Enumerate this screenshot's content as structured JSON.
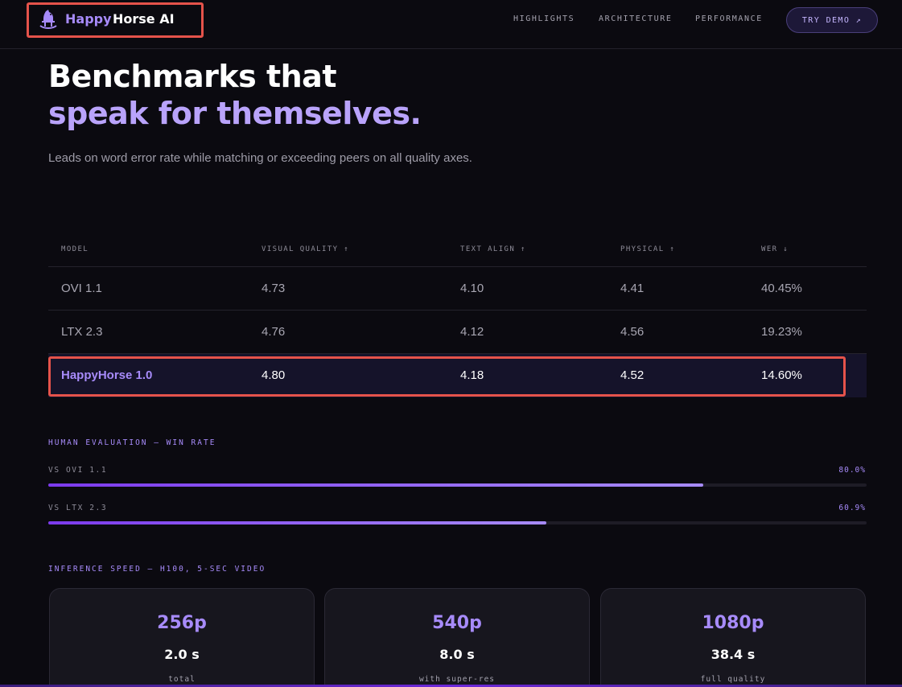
{
  "header": {
    "logo_icon": "rocking-horse-icon",
    "logo_happy": "Happy",
    "logo_horse": "Horse AI",
    "nav": [
      "HIGHLIGHTS",
      "ARCHITECTURE",
      "PERFORMANCE"
    ],
    "cta": "TRY DEMO ↗"
  },
  "hero": {
    "title_line1": "Benchmarks that",
    "title_line2": "speak for themselves.",
    "subtitle": "Leads on word error rate while matching or exceeding peers on all quality axes."
  },
  "table": {
    "headers": [
      "MODEL",
      "VISUAL QUALITY ↑",
      "TEXT ALIGN ↑",
      "PHYSICAL ↑",
      "WER ↓"
    ],
    "rows": [
      [
        "OVI 1.1",
        "4.73",
        "4.10",
        "4.41",
        "40.45%"
      ],
      [
        "LTX 2.3",
        "4.76",
        "4.12",
        "4.56",
        "19.23%"
      ],
      [
        "HappyHorse 1.0",
        "4.80",
        "4.18",
        "4.52",
        "14.60%"
      ]
    ]
  },
  "human_eval": {
    "label": "HUMAN EVALUATION — WIN RATE",
    "bars": [
      {
        "label": "VS OVI 1.1",
        "value": "80.0%",
        "fraction": 0.8
      },
      {
        "label": "VS LTX 2.3",
        "value": "60.9%",
        "fraction": 0.609
      }
    ]
  },
  "inference": {
    "label": "INFERENCE SPEED — H100, 5-SEC VIDEO",
    "cards": [
      {
        "res": "256p",
        "time": "2.0 s",
        "note": "total"
      },
      {
        "res": "540p",
        "time": "8.0 s",
        "note": "with super-res"
      },
      {
        "res": "1080p",
        "time": "38.4 s",
        "note": "full quality"
      }
    ]
  },
  "colors": {
    "accent": "#a78bfa",
    "background": "#0b0a10",
    "highlight_outline": "#e5534b"
  }
}
